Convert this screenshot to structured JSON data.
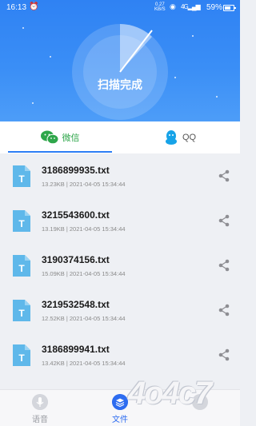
{
  "status_bar": {
    "time": "16:13",
    "speed_value": "0.27",
    "speed_unit": "KB/S",
    "network": "4G",
    "battery": "59%"
  },
  "header": {
    "title": "扫描完成"
  },
  "tabs": [
    {
      "label": "微信",
      "icon": "wechat-icon",
      "selected": true
    },
    {
      "label": "QQ",
      "icon": "qq-icon",
      "selected": false
    }
  ],
  "files": [
    {
      "name": "3186899935.txt",
      "meta": "13.23KB | 2021-04-05 15:34:44"
    },
    {
      "name": "3215543600.txt",
      "meta": "13.19KB | 2021-04-05 15:34:44"
    },
    {
      "name": "3190374156.txt",
      "meta": "15.09KB | 2021-04-05 15:34:44"
    },
    {
      "name": "3219532548.txt",
      "meta": "12.52KB | 2021-04-05 15:34:44"
    },
    {
      "name": "3186899941.txt",
      "meta": "13.42KB | 2021-04-05 15:34:44"
    }
  ],
  "file_icon_letter": "T",
  "bottom_nav": [
    {
      "label": "语音",
      "icon": "microphone-icon",
      "active": false
    },
    {
      "label": "文件",
      "icon": "file-stack-icon",
      "active": true
    },
    {
      "label": "",
      "icon": "nav-icon",
      "active": false
    }
  ],
  "watermark": "4o4c7",
  "colors": {
    "header_blue": "#2f82f3",
    "accent_blue": "#2d7ef5",
    "wechat_green": "#2ea64a",
    "qq_blue": "#17a3e8",
    "file_icon": "#5fb8ea"
  }
}
